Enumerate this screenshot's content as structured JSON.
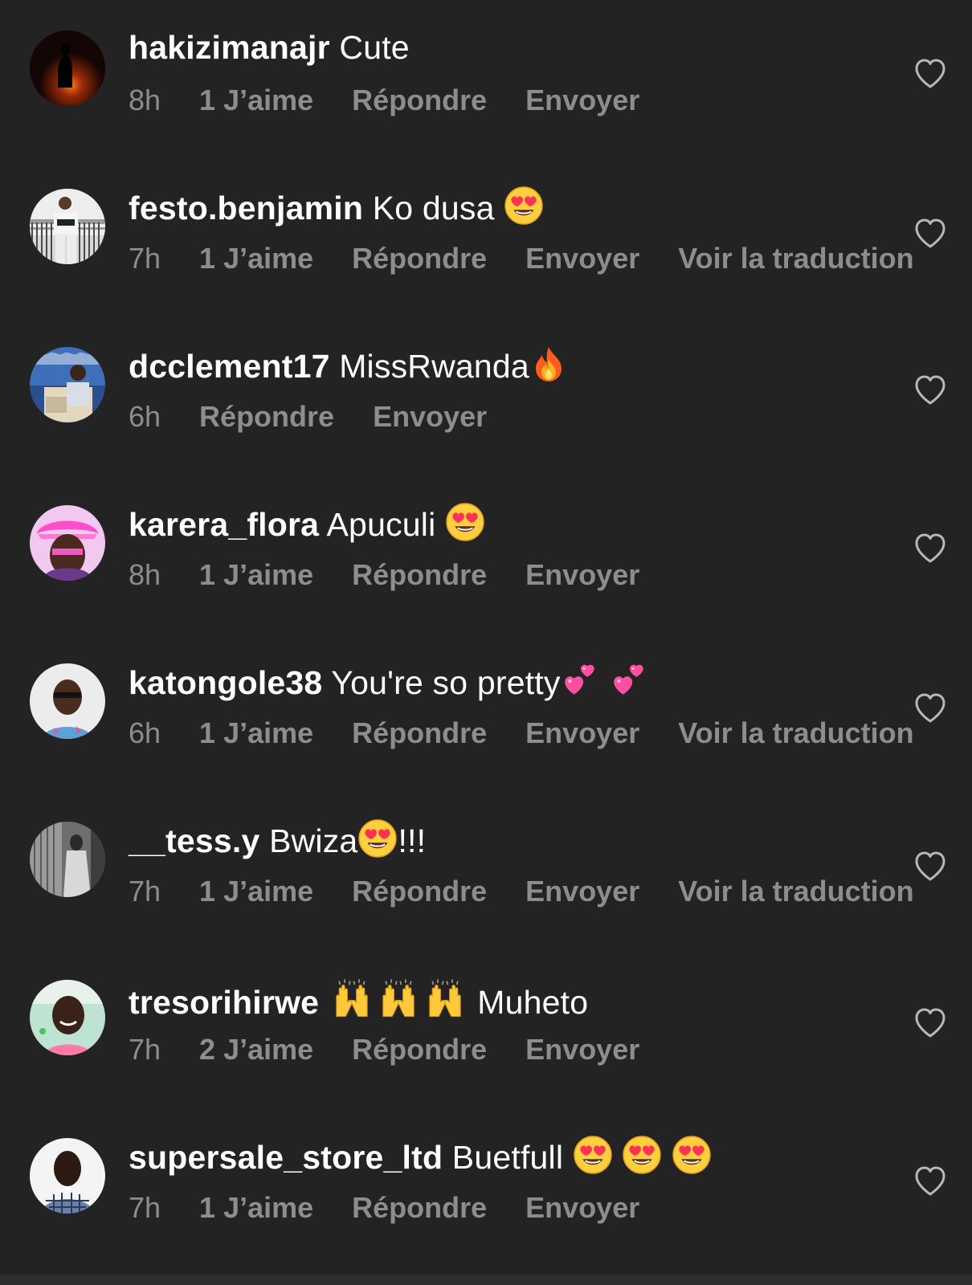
{
  "colors": {
    "background": "#232323",
    "primary_text": "#ffffff",
    "secondary_text": "#8d8d8d",
    "heart_outline": "#b8b8b8"
  },
  "icons": {
    "like": "heart-outline-icon",
    "heart_eyes": "smiling-face-with-heart-eyes-emoji",
    "fire": "fire-emoji",
    "two_hearts": "two-hearts-emoji",
    "raising_hands": "raising-hands-emoji"
  },
  "comments": [
    {
      "username": "hakizimanajr",
      "text": "Cute",
      "time": "8h",
      "likes": "1 J’aime",
      "reply": "Répondre",
      "send": "Envoyer",
      "translate": ""
    },
    {
      "username": "festo.benjamin",
      "text": "Ko dusa",
      "time": "7h",
      "likes": "1 J’aime",
      "reply": "Répondre",
      "send": "Envoyer",
      "translate": "Voir la traduction"
    },
    {
      "username": "dcclement17",
      "text": "MissRwanda",
      "time": "6h",
      "likes": "",
      "reply": "Répondre",
      "send": "Envoyer",
      "translate": ""
    },
    {
      "username": "karera_flora",
      "text": "Apuculi",
      "time": "8h",
      "likes": "1 J’aime",
      "reply": "Répondre",
      "send": "Envoyer",
      "translate": ""
    },
    {
      "username": "katongole38",
      "text": "You're so pretty",
      "time": "6h",
      "likes": "1 J’aime",
      "reply": "Répondre",
      "send": "Envoyer",
      "translate": "Voir la traduction"
    },
    {
      "username": "__tess.y",
      "text": "Bwiza",
      "text_suffix": "!!!",
      "time": "7h",
      "likes": "1 J’aime",
      "reply": "Répondre",
      "send": "Envoyer",
      "translate": "Voir la traduction"
    },
    {
      "username": "tresorihirwe",
      "text": "Muheto",
      "time": "7h",
      "likes": "2 J’aime",
      "reply": "Répondre",
      "send": "Envoyer",
      "translate": ""
    },
    {
      "username": "supersale_store_ltd",
      "text": "Buetfull",
      "time": "7h",
      "likes": "1 J’aime",
      "reply": "Répondre",
      "send": "Envoyer",
      "translate": ""
    }
  ]
}
